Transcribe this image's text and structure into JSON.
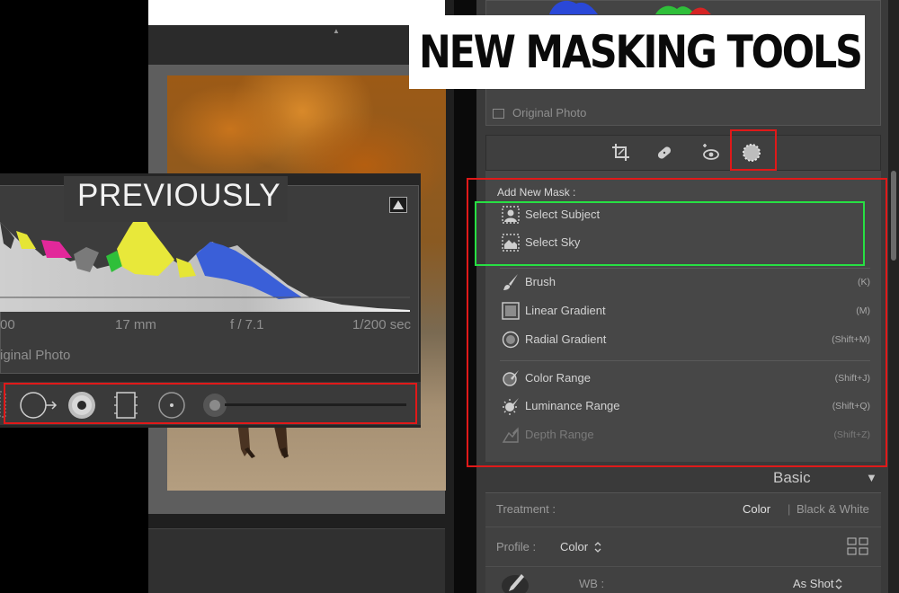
{
  "title_banner": {
    "text": "NEW MASKING TOOLS"
  },
  "previously_badge": {
    "text": "PREVIOUSLY"
  },
  "previous_panel": {
    "info": {
      "iso_partial": "00",
      "focal_length": "17 mm",
      "aperture": "f / 7.1",
      "shutter": "1/200 sec"
    },
    "original_photo_partial": "iginal Photo",
    "tools": [
      "graduated-filter-icon",
      "radial-filter-icon",
      "adjustment-brush-icon",
      "range-mask-icon",
      "brush-size-slider"
    ]
  },
  "right_panel": {
    "original_photo_label": "Original Photo",
    "tool_strip": [
      "crop-icon",
      "healing-icon",
      "red-eye-icon",
      "masking-icon"
    ],
    "add_new_mask_label": "Add New Mask :",
    "mask_items": [
      {
        "label": "Select Subject",
        "shortcut": "",
        "icon": "select-subject-icon"
      },
      {
        "label": "Select Sky",
        "shortcut": "",
        "icon": "select-sky-icon"
      },
      {
        "label": "Brush",
        "shortcut": "(K)",
        "icon": "brush-icon"
      },
      {
        "label": "Linear Gradient",
        "shortcut": "(M)",
        "icon": "linear-gradient-icon"
      },
      {
        "label": "Radial Gradient",
        "shortcut": "(Shift+M)",
        "icon": "radial-gradient-icon"
      },
      {
        "label": "Color Range",
        "shortcut": "(Shift+J)",
        "icon": "color-range-icon"
      },
      {
        "label": "Luminance Range",
        "shortcut": "(Shift+Q)",
        "icon": "luminance-range-icon"
      },
      {
        "label": "Depth Range",
        "shortcut": "(Shift+Z)",
        "icon": "depth-range-icon"
      }
    ],
    "basic": {
      "header": "Basic",
      "treatment_label": "Treatment :",
      "treatment_color": "Color",
      "treatment_bw": "Black & White",
      "profile_label": "Profile :",
      "profile_value": "Color",
      "wb_label": "WB :",
      "wb_value": "As Shot"
    }
  },
  "colors": {
    "highlight_red": "#e01919",
    "highlight_green": "#27e043",
    "panel_bg": "#474747",
    "app_bg": "#3a3a3a"
  }
}
